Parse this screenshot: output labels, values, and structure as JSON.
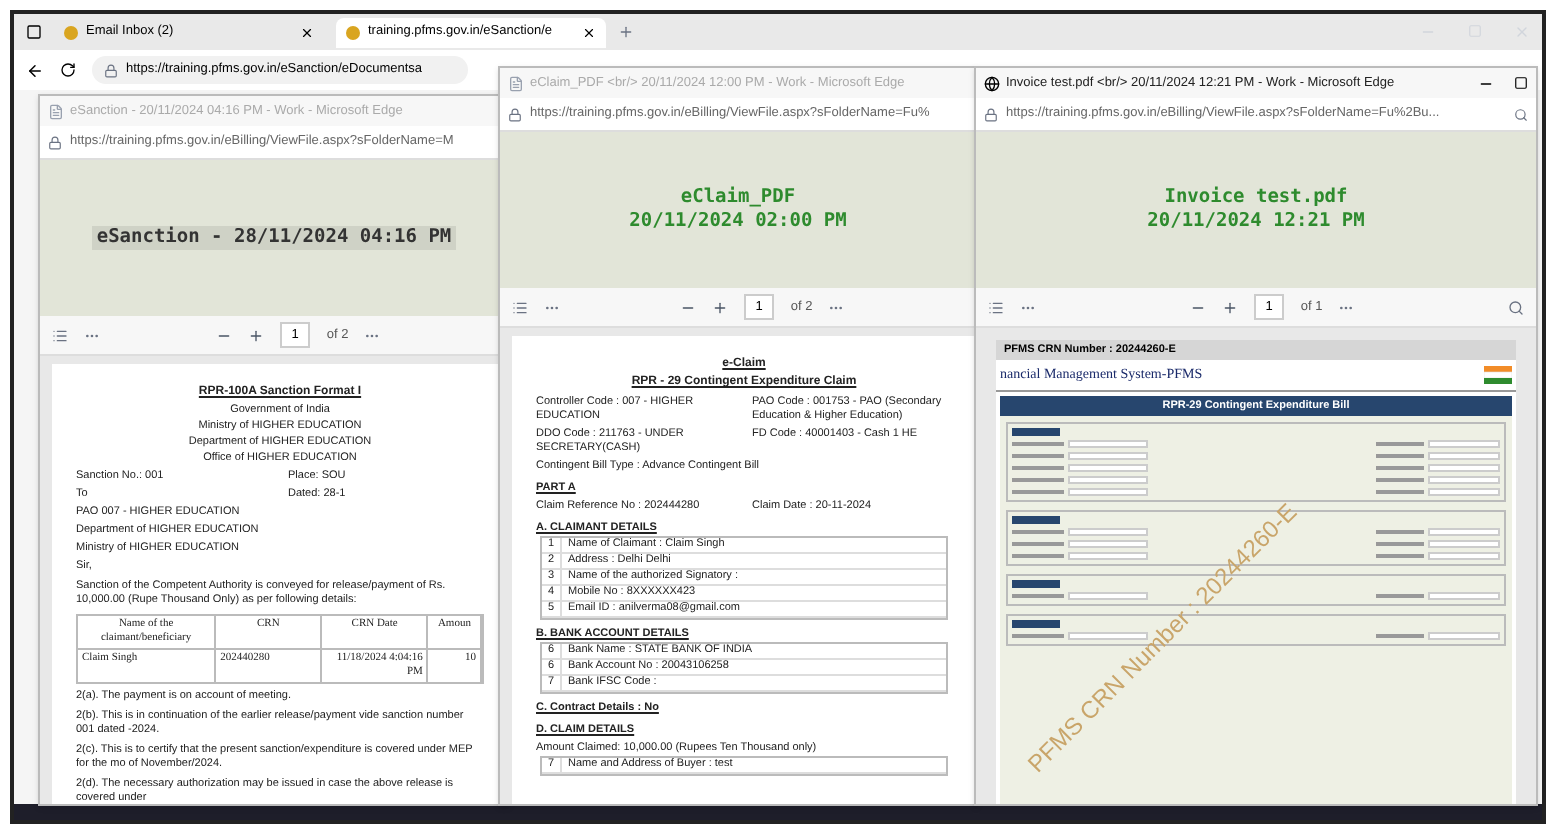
{
  "browser": {
    "tabs": [
      {
        "label": "Email Inbox (2)",
        "selected": false
      },
      {
        "label": "training.pfms.gov.in/eSanction/e",
        "selected": true
      }
    ],
    "url": "https://training.pfms.gov.in/eSanction/eDocumentsa"
  },
  "windows": [
    {
      "kind": "document",
      "active": false,
      "title": "eSanction - 20/11/2024 04:16 PM - Work - Microsoft Edge",
      "url": "https://training.pfms.gov.in/eBilling/ViewFile.aspx?sFolderName=M",
      "banner": {
        "lines": [
          "eSanction - 28/11/2024 04:16 PM"
        ],
        "color": "#333333",
        "highlighted": true
      },
      "page": "1",
      "page_count": "of 2",
      "blocks": [
        {
          "kind": "title",
          "text": "RPR-100A Sanction Format I"
        },
        {
          "kind": "center",
          "text": "Government of India"
        },
        {
          "kind": "center",
          "text": "Ministry of HIGHER EDUCATION"
        },
        {
          "kind": "center",
          "text": "Department of HIGHER EDUCATION"
        },
        {
          "kind": "center",
          "text": "Office of HIGHER EDUCATION"
        },
        {
          "kind": "pair",
          "left": "Sanction No.: 001",
          "right": "Place: SOU"
        },
        {
          "kind": "pair",
          "left": "To",
          "right": "Dated: 28-1"
        },
        {
          "kind": "text",
          "text": "PAO 007 - HIGHER EDUCATION"
        },
        {
          "kind": "text",
          "text": "Department of HIGHER EDUCATION"
        },
        {
          "kind": "text",
          "text": "Ministry of HIGHER EDUCATION"
        },
        {
          "kind": "text",
          "text": "Sir,"
        },
        {
          "kind": "paragraph",
          "text": "Sanction of the Competent Authority is conveyed for release/payment of Rs. 10,000.00 (Rupe Thousand Only) as per following details:"
        },
        {
          "kind": "grid",
          "columns": [
            "Name of the claimant/beneficiary",
            "CRN",
            "CRN Date",
            "Amoun"
          ],
          "rows": [
            [
              "Claim Singh",
              "202440280",
              "11/18/2024 4:04:16 PM",
              "10"
            ]
          ]
        },
        {
          "kind": "paragraph",
          "text": "2(a). The payment is on account of meeting."
        },
        {
          "kind": "paragraph",
          "text": "2(b). This is in continuation of the earlier release/payment vide sanction number 001 dated -2024."
        },
        {
          "kind": "paragraph",
          "text": "2(c). This is to certify that the present sanction/expenditure is covered under MEP for the mo of November/2024."
        },
        {
          "kind": "paragraph",
          "text": "2(d). The necessary authorization may be issued in case the above release is covered under"
        }
      ]
    },
    {
      "kind": "document",
      "active": false,
      "title": "eClaim_PDF <br/> 20/11/2024 12:00 PM - Work - Microsoft Edge",
      "url": "https://training.pfms.gov.in/eBilling/ViewFile.aspx?sFolderName=Fu%",
      "banner": {
        "lines": [
          "eClaim_PDF",
          "20/11/2024 02:00 PM"
        ],
        "color": "#2e8b2e",
        "highlighted": false
      },
      "page": "1",
      "page_count": "of 2",
      "blocks": [
        {
          "kind": "title",
          "text": "e-Claim"
        },
        {
          "kind": "title",
          "text": "RPR - 29 Contingent Expenditure Claim"
        },
        {
          "kind": "pair",
          "left": "Controller Code : 007 - HIGHER EDUCATION",
          "right": "PAO Code : 001753 - PAO (Secondary Education & Higher Education)"
        },
        {
          "kind": "pair",
          "left": "DDO Code : 211763 - UNDER SECRETARY(CASH)",
          "right": "FD Code : 40001403 - Cash 1 HE"
        },
        {
          "kind": "text",
          "text": "Contingent Bill Type : Advance Contingent Bill"
        },
        {
          "kind": "heading",
          "text": "PART A"
        },
        {
          "kind": "pair",
          "left": "Claim Reference No : 202444280",
          "right": "Claim Date : 20-11-2024"
        },
        {
          "kind": "heading",
          "text": "A. CLAIMANT DETAILS"
        },
        {
          "kind": "numbered",
          "rows": [
            {
              "no": "1",
              "text": "Name of Claimant : Claim Singh"
            },
            {
              "no": "2",
              "text": "Address : Delhi  Delhi"
            },
            {
              "no": "3",
              "text": "Name of the authorized Signatory :"
            },
            {
              "no": "4",
              "text": "Mobile No : 8XXXXXX423"
            },
            {
              "no": "5",
              "text": "Email ID : anilverma08@gmail.com"
            }
          ]
        },
        {
          "kind": "heading",
          "text": "B. BANK ACCOUNT DETAILS"
        },
        {
          "kind": "numbered",
          "rows": [
            {
              "no": "6",
              "text": "Bank Name : STATE BANK OF INDIA"
            },
            {
              "no": "6",
              "text": "Bank Account No : 20043106258"
            },
            {
              "no": "7",
              "text": "Bank IFSC Code :"
            }
          ]
        },
        {
          "kind": "heading",
          "text": "C. Contract Details : No"
        },
        {
          "kind": "heading",
          "text": "D. CLAIM DETAILS"
        },
        {
          "kind": "text",
          "text": "Amount Claimed: 10,000.00 (Rupees Ten Thousand only)"
        },
        {
          "kind": "numbered",
          "rows": [
            {
              "no": "7",
              "text": "Name and Address of Buyer : test"
            }
          ]
        }
      ]
    },
    {
      "kind": "invoice",
      "active": true,
      "title": "Invoice test.pdf <br/> 20/11/2024 12:21 PM - Work - Microsoft Edge",
      "url": "https://training.pfms.gov.in/eBilling/ViewFile.aspx?sFolderName=Fu%2Bu...",
      "banner": {
        "lines": [
          "Invoice test.pdf",
          "20/11/2024 12:21 PM"
        ],
        "color": "#2e8b2e",
        "highlighted": false
      },
      "page": "1",
      "page_count": "of 1",
      "invoice": {
        "crn_header": "PFMS CRN Number : 20244260-E",
        "system_title": "nancial Management System-PFMS",
        "form_title": "RPR-29 Contingent Expenditure Bill",
        "watermark": "PFMS CRN Number : 20244260-E"
      }
    }
  ]
}
